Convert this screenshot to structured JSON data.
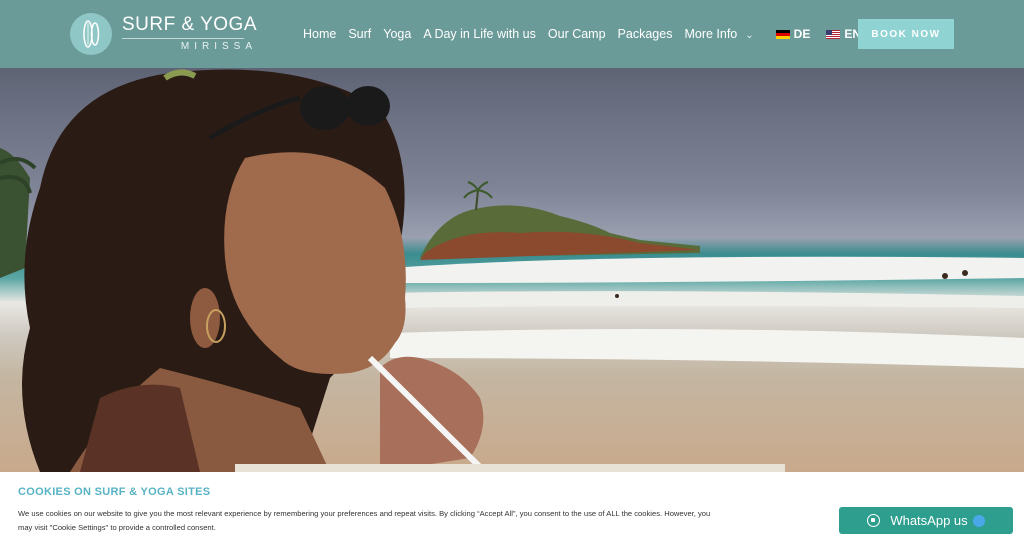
{
  "brand": {
    "title": "SURF & YOGA",
    "subtitle": "MIRISSA"
  },
  "nav": {
    "items": [
      {
        "label": "Home"
      },
      {
        "label": "Surf"
      },
      {
        "label": "Yoga"
      },
      {
        "label": "A Day in Life with us"
      },
      {
        "label": "Our Camp"
      },
      {
        "label": "Packages"
      },
      {
        "label": "More Info"
      }
    ],
    "languages": [
      {
        "code": "DE",
        "icon": "german-flag-icon"
      },
      {
        "code": "EN",
        "icon": "us-flag-icon"
      }
    ],
    "book_label": "BOOK NOW"
  },
  "hero": {
    "image": "woman-drinking-coconut-on-beach"
  },
  "cookie": {
    "title": "COOKIES ON SURF & YOGA SITES",
    "text": "We use cookies on our website to give you the most relevant experience by remembering your preferences and repeat visits. By clicking “Accept All”, you consent to the use of ALL the cookies. However, you may visit \"Cookie Settings\" to provide a controlled consent."
  },
  "whatsapp": {
    "label": "WhatsApp us",
    "icon": "whatsapp-icon"
  },
  "colors": {
    "header_bg": "#6b9b99",
    "book_bg": "#8fd3d3",
    "cookie_title": "#57b3c4",
    "whatsapp_bg": "#2e9e8f"
  }
}
